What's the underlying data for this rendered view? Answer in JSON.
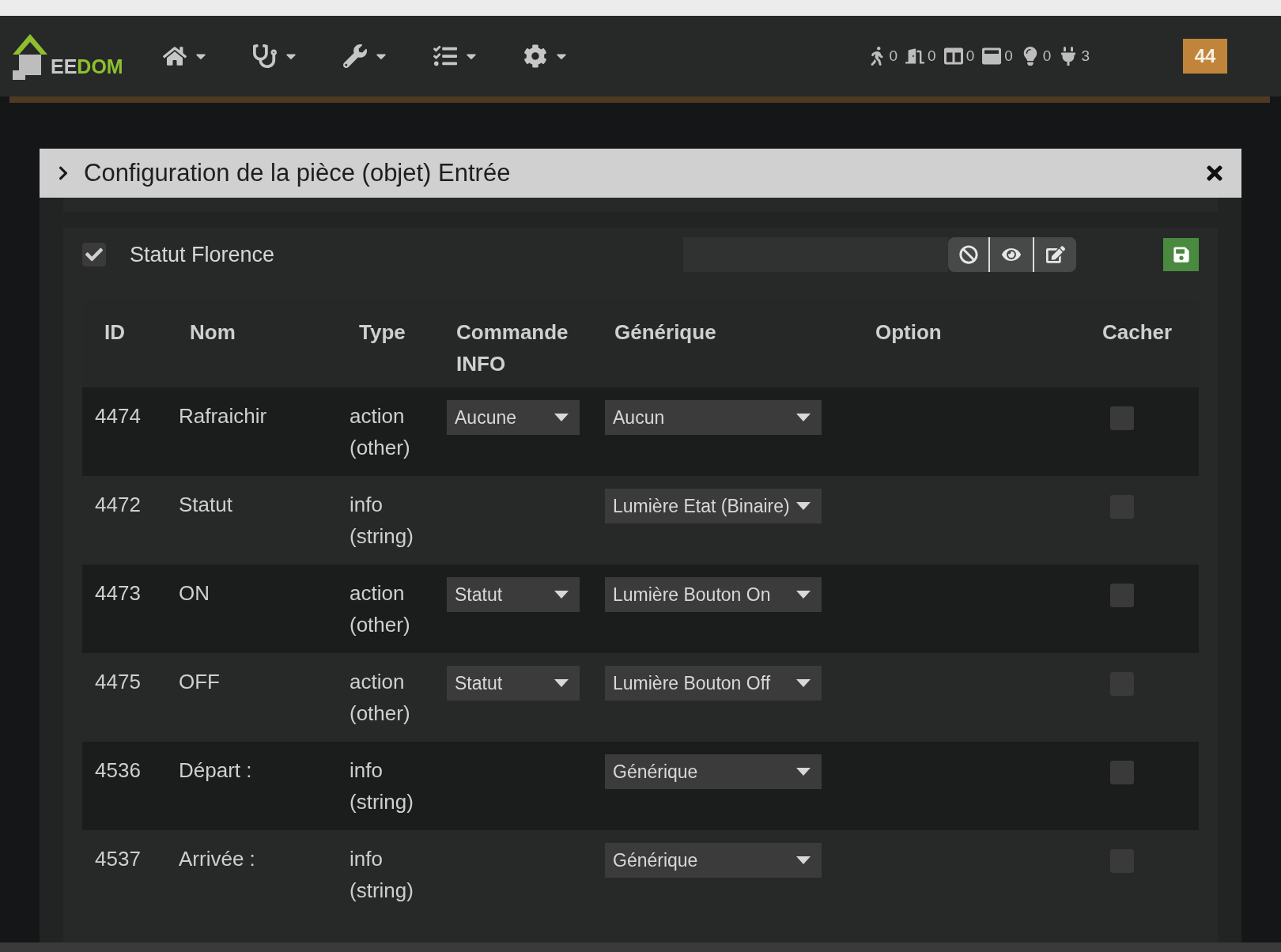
{
  "navbar": {
    "logo": {
      "prefix": "EE",
      "accent": "DOM"
    },
    "menus": [
      {
        "kind": "home"
      },
      {
        "kind": "health"
      },
      {
        "kind": "tools"
      },
      {
        "kind": "tasks"
      },
      {
        "kind": "settings"
      }
    ],
    "counters": [
      {
        "kind": "motion",
        "count": "0"
      },
      {
        "kind": "door",
        "count": "0"
      },
      {
        "kind": "window",
        "count": "0"
      },
      {
        "kind": "shutter",
        "count": "0"
      },
      {
        "kind": "light",
        "count": "0"
      },
      {
        "kind": "plug",
        "count": "3"
      }
    ],
    "badge": "44"
  },
  "modal": {
    "title": "Configuration de la pièce (objet) Entrée",
    "equipment": {
      "name": "Statut Florence",
      "checked": true
    },
    "table": {
      "columns": [
        "ID",
        "Nom",
        "Type",
        "Commande INFO",
        "Générique",
        "Option",
        "Cacher"
      ],
      "rows": [
        {
          "id": "4474",
          "name": "Rafraichir",
          "type": "action (other)",
          "command": "Aucune",
          "generic": "Aucun",
          "hidden": false
        },
        {
          "id": "4472",
          "name": "Statut",
          "type": "info (string)",
          "generic": "Lumière Etat (Binaire)",
          "hidden": false
        },
        {
          "id": "4473",
          "name": "ON",
          "type": "action (other)",
          "command": "Statut",
          "generic": "Lumière Bouton On",
          "hidden": false
        },
        {
          "id": "4475",
          "name": "OFF",
          "type": "action (other)",
          "command": "Statut",
          "generic": "Lumière Bouton Off",
          "hidden": false
        },
        {
          "id": "4536",
          "name": "Départ :",
          "type": "info (string)",
          "generic": "Générique",
          "hidden": false
        },
        {
          "id": "4537",
          "name": "Arrivée :",
          "type": "info (string)",
          "generic": "Générique",
          "hidden": false
        }
      ]
    }
  }
}
